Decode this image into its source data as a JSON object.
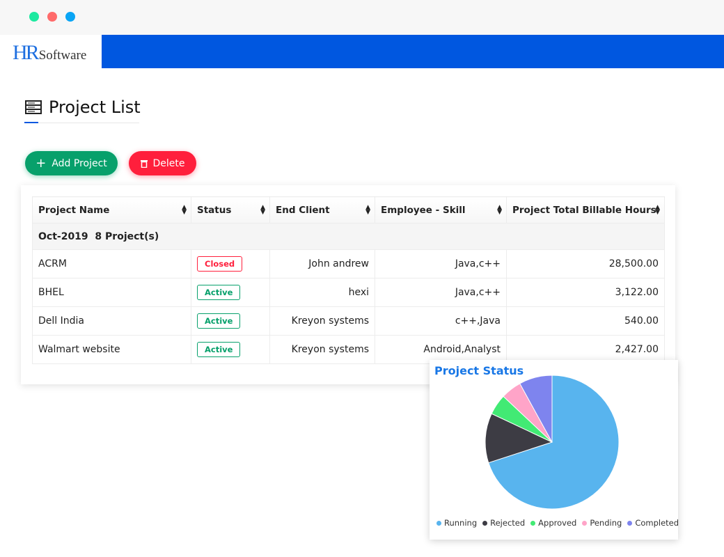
{
  "window": {
    "dots": [
      "#1de9a0",
      "#ff6b6b",
      "#0aa5f5"
    ]
  },
  "brand": {
    "logo_mark": "HR",
    "logo_text": "Software",
    "bar_color": "#0057e0"
  },
  "page": {
    "title": "Project List",
    "icon": "server-list-icon"
  },
  "toolbar": {
    "add_label": "Add Project",
    "delete_label": "Delete"
  },
  "table": {
    "columns": [
      "Project Name",
      "Status",
      "End Client",
      "Employee - Skill",
      "Project Total Billable Hours"
    ],
    "group": {
      "month": "Oct-2019",
      "count": "8 Project(s)"
    },
    "rows": [
      {
        "name": "ACRM",
        "status": "Closed",
        "client": "John andrew",
        "skill": "Java,c++",
        "hours": "28,500.00"
      },
      {
        "name": "BHEL",
        "status": "Active",
        "client": "hexi",
        "skill": "Java,c++",
        "hours": "3,122.00"
      },
      {
        "name": "Dell India",
        "status": "Active",
        "client": "Kreyon systems",
        "skill": "c++,Java",
        "hours": "540.00"
      },
      {
        "name": "Walmart website",
        "status": "Active",
        "client": "Kreyon systems",
        "skill": "Android,Analyst",
        "hours": "2,427.00"
      }
    ]
  },
  "chart_data": {
    "type": "pie",
    "title": "Project Status",
    "legend": "bottom",
    "categories": [
      "Running",
      "Rejected",
      "Approved",
      "Pending",
      "Completed"
    ],
    "values": [
      70,
      12,
      5,
      5,
      8
    ],
    "colors": [
      "#58b4ee",
      "#3d3c44",
      "#42ea74",
      "#ffa4c8",
      "#7e84ee"
    ]
  }
}
